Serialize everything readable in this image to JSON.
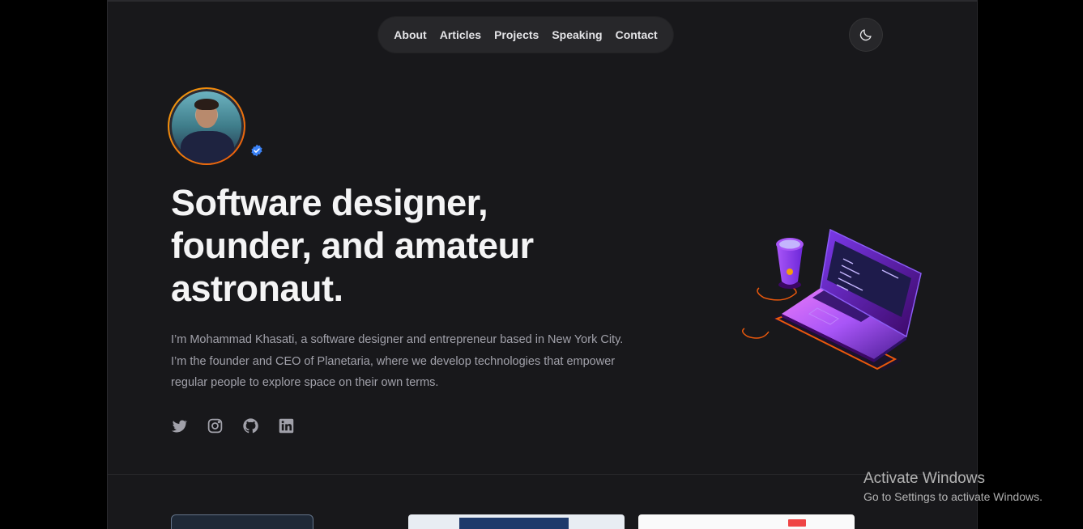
{
  "nav": {
    "items": [
      {
        "label": "About"
      },
      {
        "label": "Articles"
      },
      {
        "label": "Projects"
      },
      {
        "label": "Speaking"
      },
      {
        "label": "Contact"
      }
    ]
  },
  "theme_toggle": {
    "icon": "moon-icon"
  },
  "hero": {
    "headline": "Software designer, founder, and amateur astronaut.",
    "intro": "I’m Mohammad Khasati, a software designer and entrepreneur based in New York City. I’m the founder and CEO of Planetaria, where we develop technologies that empower regular people to explore space on their own terms.",
    "verified_icon": "verified-badge-icon",
    "social_icons": [
      "twitter-icon",
      "instagram-icon",
      "github-icon",
      "linkedin-icon"
    ]
  },
  "watermark": {
    "line1": "Activate Windows",
    "line2": "Go to Settings to activate Windows."
  },
  "colors": {
    "page_bg": "#18181b",
    "outer_bg": "#000000",
    "nav_bg": "#27272a",
    "text": "#f4f4f5",
    "muted": "#a1a1aa",
    "accent": "#8b5cf6",
    "verified": "#3b82f6"
  }
}
